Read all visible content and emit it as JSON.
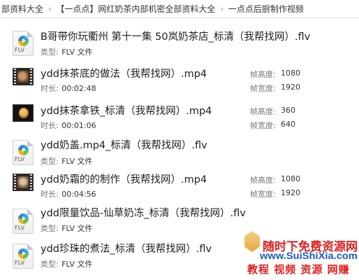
{
  "breadcrumb": [
    "部资料大全",
    "【一点点】网红奶茶内部机密全部资料大全",
    "一点点后厨制作视频"
  ],
  "labels": {
    "type": "类型:",
    "duration": "时长:",
    "frame_height": "帧高度:",
    "frame_width": "帧宽度:"
  },
  "files": [
    {
      "name": "B哥带你玩衢州 第十一集 50岚奶茶店_标清（我帮找网）.flv",
      "type": "FLV 文件",
      "icon": "flv-file-icon"
    },
    {
      "name": "ydd抹茶底的做法（我帮找网）.mp4",
      "duration": "00:02:48",
      "frame_height": "1080",
      "frame_width": "1920",
      "icon": "video-thumbnail"
    },
    {
      "name": "ydd抹茶拿铁_标清（我帮找网）.mp4",
      "duration": "00:01:06",
      "frame_height": "360",
      "frame_width": "640",
      "icon": "video-thumbnail"
    },
    {
      "name": "ydd奶盖.mp4_标清（我帮找网）.flv",
      "type": "FLV 文件",
      "icon": "flv-file-icon"
    },
    {
      "name": "ydd奶霜的的制作（我帮找网）.mp4",
      "duration": "00:04:56",
      "frame_height": "1080",
      "frame_width": "1920",
      "icon": "video-thumbnail"
    },
    {
      "name": "ydd限量饮品-仙草奶冻_标清（我帮找网）.flv",
      "type": "FLV 文件",
      "icon": "flv-file-icon"
    },
    {
      "name": "ydd珍珠的煮法_标清（我帮找网）.flv",
      "type": "FLV 文件",
      "icon": "flv-file-icon"
    }
  ],
  "flv_icon_ext": "FLV",
  "watermark": {
    "line1": "随时下免费资源网",
    "url": "www.SuiShiXia.com",
    "line2": "教程 视频 资源 网赚"
  }
}
